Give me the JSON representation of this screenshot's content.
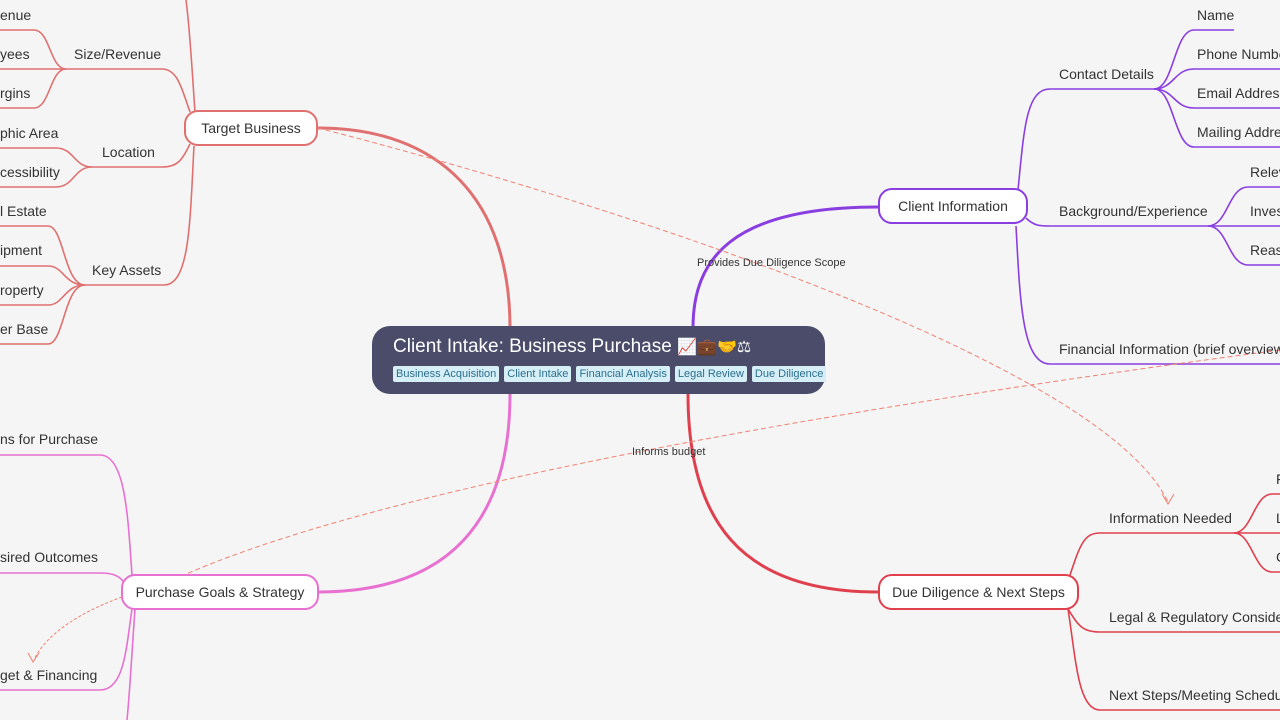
{
  "root": {
    "title": "Client Intake: Business Purchase",
    "emojis": "📈💼🤝⚖",
    "tags": [
      "Business Acquisition",
      "Client Intake",
      "Financial Analysis",
      "Legal Review",
      "Due Diligence"
    ]
  },
  "colors": {
    "target": "#e07070",
    "client": "#8a3ee0",
    "goals": "#e770d0",
    "due": "#e0404e",
    "relation": "#f08070",
    "root_bg": "#4a4c6a",
    "background": "#f5f5f5"
  },
  "branches": {
    "target_business": {
      "label": "Target Business",
      "children": [
        {
          "label": "Size/Revenue",
          "children": [
            "enue",
            "yees",
            "rgins"
          ]
        },
        {
          "label": "Location",
          "children": [
            "phic Area",
            "cessibility"
          ]
        },
        {
          "label": "Key Assets",
          "children": [
            "l Estate",
            "ipment",
            "roperty",
            "er Base"
          ]
        }
      ]
    },
    "client_information": {
      "label": "Client Information",
      "children": [
        {
          "label": "Contact Details",
          "children": [
            "Name",
            "Phone Numbe",
            "Email Address",
            "Mailing Addres"
          ]
        },
        {
          "label": "Background/Experience",
          "children": [
            "Relev",
            "Inves",
            "Reas"
          ]
        },
        {
          "label": "Financial Information (brief overview",
          "children": []
        }
      ]
    },
    "purchase_goals": {
      "label": "Purchase Goals & Strategy",
      "children": [
        {
          "label": "ns for Purchase"
        },
        {
          "label": "sired Outcomes"
        },
        {
          "label": "get & Financing"
        }
      ]
    },
    "due_diligence": {
      "label": "Due Diligence & Next Steps",
      "children": [
        {
          "label": "Information Needed",
          "children": [
            "F",
            "L",
            "C"
          ]
        },
        {
          "label": "Legal & Regulatory Considera"
        },
        {
          "label": "Next Steps/Meeting Schedule"
        }
      ]
    }
  },
  "relations": [
    {
      "from": "Target Business",
      "to": "Information Needed",
      "label": "Provides Due Diligence Scope"
    },
    {
      "from": "Financial Information (brief overview",
      "to": "Budget & Financing",
      "label": "Informs budget"
    }
  ]
}
